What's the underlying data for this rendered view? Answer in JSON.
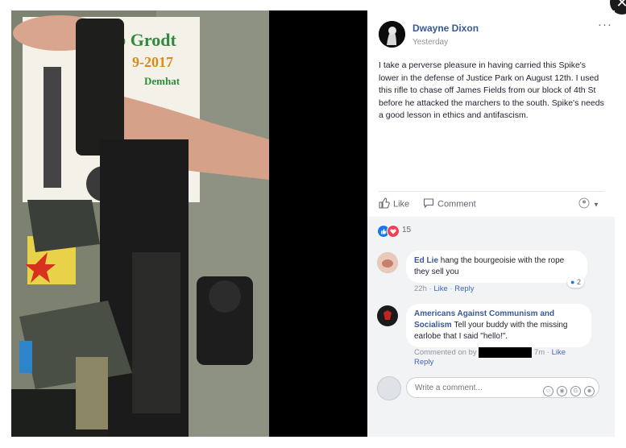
{
  "photo": {
    "sign_line1": "b Grodt",
    "sign_line2": "9-2017",
    "sign_line3": "Demhat"
  },
  "post": {
    "author": "Dwayne Dixon",
    "timestamp": "Yesterday",
    "more_label": "···",
    "text": "I take a perverse pleasure in having carried this Spike's lower in the defense of Justice Park on August 12th. I used this rifle to chase off James Fields from our block of 4th St before he attacked the marchers to the south. Spike's needs a good lesson in ethics and antifascism.",
    "like_label": "Like",
    "comment_label": "Comment",
    "reaction_count": "15"
  },
  "comments": [
    {
      "author": "Ed Lie",
      "text": "hang the bourgeoisie with the rope they sell you",
      "time": "22h",
      "like": "Like",
      "reply": "Reply",
      "likes": "2"
    },
    {
      "author": "Americans Against Communism and Socialism",
      "text": "Tell your buddy with the missing earlobe that I said \"hello!\".",
      "commented_on_by": "Commented on by",
      "time": "7m",
      "like": "Like",
      "reply": "Reply"
    }
  ],
  "composer": {
    "placeholder": "Write a comment..."
  },
  "colors": {
    "link": "#385898",
    "like_blue": "#1877f2",
    "love_red": "#f33e58"
  }
}
